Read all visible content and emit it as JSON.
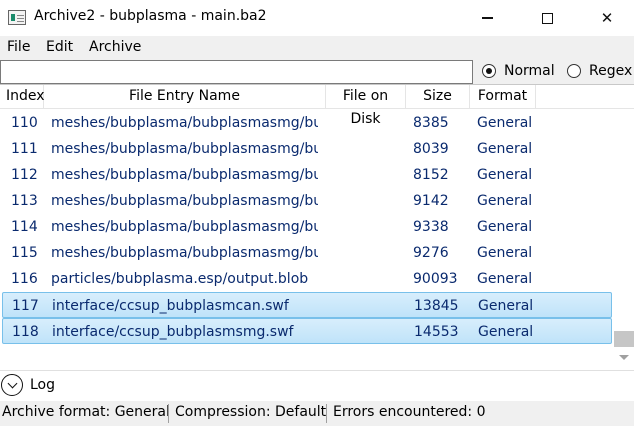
{
  "window": {
    "title": "Archive2 - bubplasma - main.ba2",
    "minimize_glyph": "—",
    "close_glyph": "✕"
  },
  "menu": {
    "file": "File",
    "edit": "Edit",
    "archive": "Archive"
  },
  "search": {
    "value": "",
    "placeholder": "",
    "mode_normal": "Normal",
    "mode_regex": "Regex",
    "selected_mode": "Normal"
  },
  "columns": {
    "index": "Index",
    "name": "File Entry Name",
    "disk": "File on Disk",
    "size": "Size",
    "format": "Format"
  },
  "rows": [
    {
      "index": "110",
      "name": "meshes/bubplasma/bubplasmasmg/bub",
      "disk": "",
      "size": "8385",
      "format": "General",
      "selected": false
    },
    {
      "index": "111",
      "name": "meshes/bubplasma/bubplasmasmg/bub",
      "disk": "",
      "size": "8039",
      "format": "General",
      "selected": false
    },
    {
      "index": "112",
      "name": "meshes/bubplasma/bubplasmasmg/bub",
      "disk": "",
      "size": "8152",
      "format": "General",
      "selected": false
    },
    {
      "index": "113",
      "name": "meshes/bubplasma/bubplasmasmg/bub",
      "disk": "",
      "size": "9142",
      "format": "General",
      "selected": false
    },
    {
      "index": "114",
      "name": "meshes/bubplasma/bubplasmasmg/bub",
      "disk": "",
      "size": "9338",
      "format": "General",
      "selected": false
    },
    {
      "index": "115",
      "name": "meshes/bubplasma/bubplasmasmg/bub",
      "disk": "",
      "size": "9276",
      "format": "General",
      "selected": false
    },
    {
      "index": "116",
      "name": "particles/bubplasma.esp/output.blob",
      "disk": "",
      "size": "90093",
      "format": "General",
      "selected": false
    },
    {
      "index": "117",
      "name": "interface/ccsup_bubplasmcan.swf",
      "disk": "",
      "size": "13845",
      "format": "General",
      "selected": true
    },
    {
      "index": "118",
      "name": "interface/ccsup_bubplasmsmg.swf",
      "disk": "",
      "size": "14553",
      "format": "General",
      "selected": true
    }
  ],
  "log": {
    "label": "Log"
  },
  "status": {
    "archive_format": "Archive format:  General",
    "compression": "Compression:  Default",
    "errors": "Errors encountered:  0"
  },
  "colors": {
    "row_text": "#0a2a6e",
    "selection_fill": "#c9e8fb",
    "selection_border": "#78c0ea",
    "chrome": "#f0f0f0"
  },
  "icons": [
    "app-icon",
    "minimize-icon",
    "maximize-icon",
    "close-icon",
    "chevron-down-icon"
  ]
}
